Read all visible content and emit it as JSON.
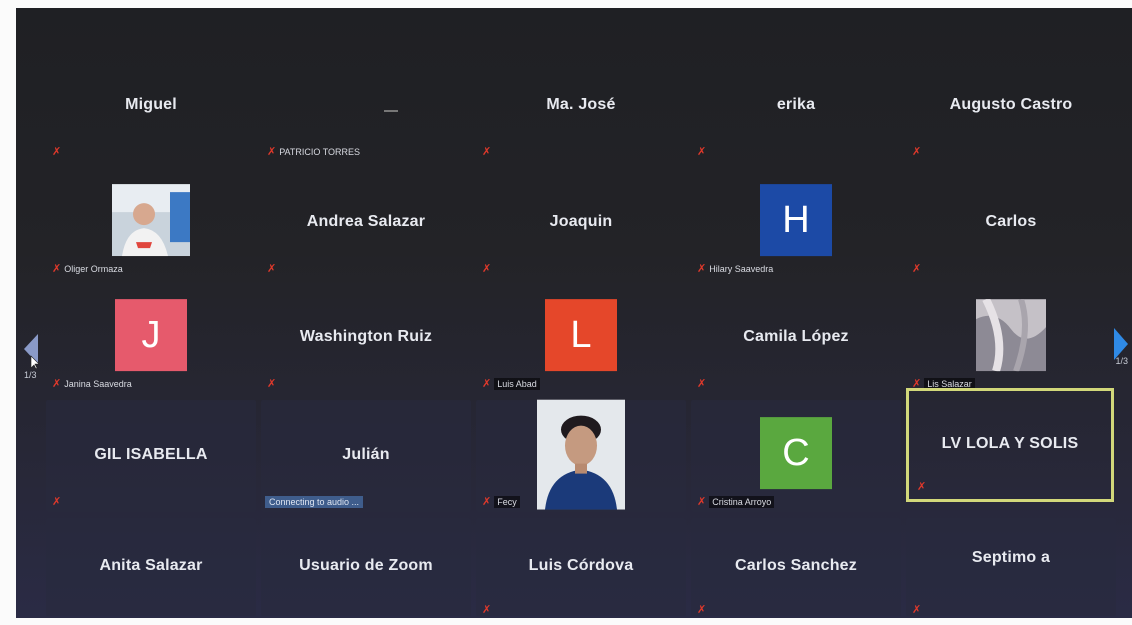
{
  "navigation": {
    "page_left": "1/3",
    "page_right": "1/3"
  },
  "colors": {
    "muted_icon": "#e0392b",
    "active_speaker_border": "#d2d87a",
    "avatar_H": "#1c4aa6",
    "avatar_J": "#e65a6c",
    "avatar_L": "#e5472a",
    "avatar_C": "#5aa83f"
  },
  "rows": [
    [
      {
        "name": "Miguel",
        "label": ""
      },
      {
        "name": "",
        "label": "PATRICIO TORRES"
      },
      {
        "name": "Ma. José",
        "label": ""
      },
      {
        "name": "erika",
        "label": ""
      },
      {
        "name": "Augusto Castro",
        "label": ""
      }
    ],
    [
      {
        "name": "",
        "label": "Oliger Ormaza",
        "video": "photo"
      },
      {
        "name": "Andrea Salazar",
        "label": ""
      },
      {
        "name": "Joaquin",
        "label": ""
      },
      {
        "name": "",
        "label": "Hilary Saavedra",
        "avatar": "H"
      },
      {
        "name": "Carlos",
        "label": ""
      }
    ],
    [
      {
        "name": "",
        "label": "Janina Saavedra",
        "avatar": "J"
      },
      {
        "name": "Washington Ruiz",
        "label": ""
      },
      {
        "name": "",
        "label": "Luis Abad",
        "avatar": "L"
      },
      {
        "name": "Camila López",
        "label": ""
      },
      {
        "name": "",
        "label": "Lis Salazar",
        "video": "photo"
      }
    ],
    [
      {
        "name": "GIL ISABELLA",
        "label": ""
      },
      {
        "name": "Julián",
        "label": "",
        "status": "Connecting to audio ..."
      },
      {
        "name": "",
        "label": "Fecy",
        "video": "photo"
      },
      {
        "name": "",
        "label": "Cristina Arroyo",
        "avatar": "C"
      },
      {
        "name": "LV LOLA Y SOLIS",
        "label": "",
        "active": true
      }
    ],
    [
      {
        "name": "Anita Salazar",
        "label": ""
      },
      {
        "name": "Usuario de Zoom",
        "label": ""
      },
      {
        "name": "Luis Córdova",
        "label": ""
      },
      {
        "name": "Carlos Sanchez",
        "label": ""
      },
      {
        "name": "Septimo a",
        "label": ""
      }
    ]
  ]
}
